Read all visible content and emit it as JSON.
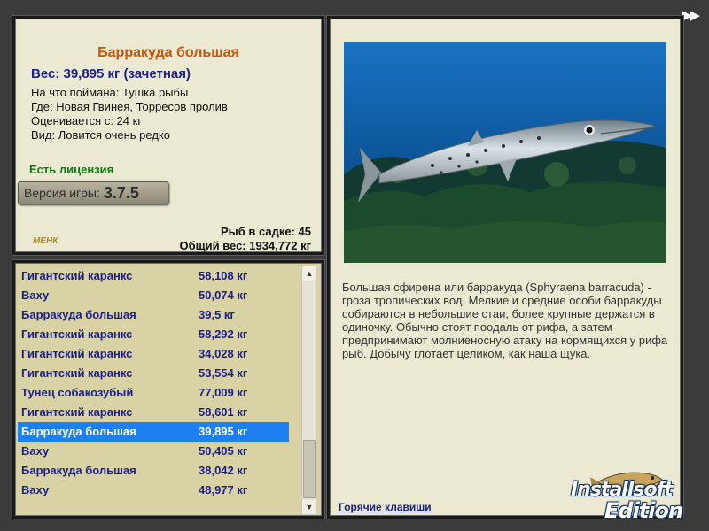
{
  "toolbar": {
    "skip_icon": "fast-forward-icon",
    "skip_glyph": "▶▶"
  },
  "info": {
    "title": "Барракуда большая",
    "weight": "Вес: 39,895 кг (зачетная)",
    "caught_with": "На что поймана: Тушка рыбы",
    "location": "Где: Новая Гвинея, Торресов пролив",
    "valued_from": "Оценивается с: 24 кг",
    "kind": "Вид: Ловится очень редко",
    "license": "Есть лицензия",
    "version_label": "Версия игры:",
    "version_number": "3.7.5",
    "logo": "МЕНК",
    "fish_in_cage": "Рыб в садке: 45",
    "total_weight": "Общий вес: 1934,772 кг"
  },
  "catch_list": {
    "rows": [
      {
        "name": "Гигантский каранкс",
        "weight": "58,108 кг"
      },
      {
        "name": "Ваху",
        "weight": "50,074 кг"
      },
      {
        "name": "Барракуда большая",
        "weight": "39,5 кг"
      },
      {
        "name": "Гигантский каранкс",
        "weight": "58,292 кг"
      },
      {
        "name": "Гигантский каранкс",
        "weight": "34,028 кг"
      },
      {
        "name": "Гигантский каранкс",
        "weight": "53,554 кг"
      },
      {
        "name": "Тунец собакозубый",
        "weight": "77,009 кг"
      },
      {
        "name": "Гигантский каранкс",
        "weight": "58,601 кг"
      },
      {
        "name": "Барракуда большая",
        "weight": "39,895 кг"
      },
      {
        "name": "Ваху",
        "weight": "50,405 кг"
      },
      {
        "name": "Барракуда большая",
        "weight": "38,042 кг"
      },
      {
        "name": "Ваху",
        "weight": "48,977 кг"
      }
    ],
    "selected_index": 8,
    "scroll_up_glyph": "▲",
    "scroll_down_glyph": "▼"
  },
  "detail": {
    "description": "Большая сфирена или барракуда (Sphyraena barracuda) - гроза тропических вод. Мелкие и средние особи барракуды собираются в небольшие стаи, более крупные держатся в одиночку. Обычно стоят поодаль от рифа, а затем предпринимают молниеносную атаку на кормящихся у рифа рыб. Добычу глотает целиком, как наша щука.",
    "hotkeys_link": "Горячие клавиши"
  },
  "watermark": {
    "line1": "Installsoft",
    "line2": "Edition"
  },
  "colors": {
    "panel_bg": "#ece9d2",
    "list_bg": "#d8d2a4",
    "title_orange": "#c4560e",
    "accent_blue": "#1a1f8e",
    "selection": "#1e80f0",
    "license_green": "#0a7a13"
  }
}
